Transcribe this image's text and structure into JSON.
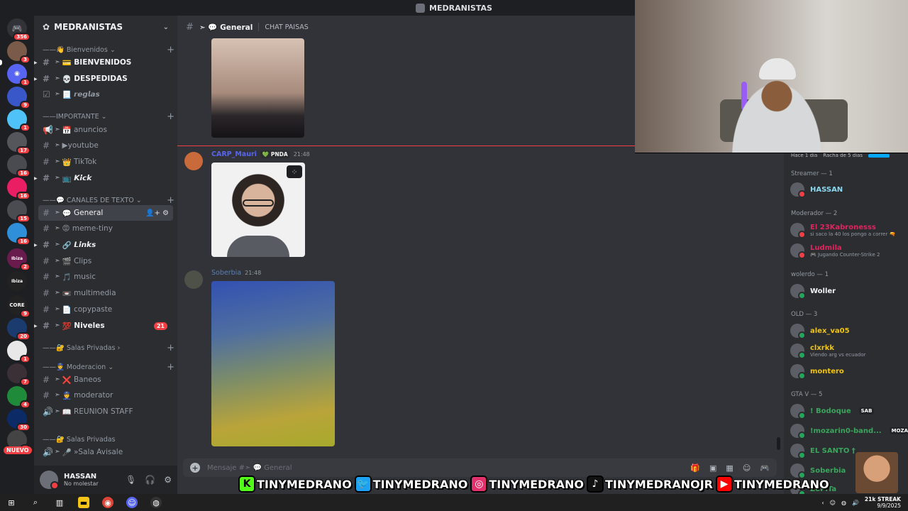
{
  "window": {
    "title": "MEDRANISTAS"
  },
  "rail": {
    "badges": [
      "356",
      "3",
      "1",
      "9",
      "1",
      "17",
      "16",
      "16",
      "15",
      "16",
      "2",
      "9",
      "20",
      "1",
      "7",
      "4",
      "30",
      "1"
    ],
    "nuevo_label": "NUEVO",
    "server_tags": [
      "Ibiza",
      "Ibiza",
      "CORE"
    ]
  },
  "sidebar": {
    "server_name": "MEDRANISTAS",
    "categories": [
      {
        "label": "Bienvenidos",
        "icon": "👋"
      },
      {
        "label": "IMPORTANTE"
      },
      {
        "label": "CANALES DE TEXTO",
        "icon": "💬"
      },
      {
        "label": "Salas Privadas",
        "icon": "🔐"
      },
      {
        "label": "Moderacion",
        "icon": "👮"
      },
      {
        "label": "Salas Privadas",
        "icon": "🔐"
      }
    ],
    "channels": [
      {
        "label": "BIENVENIDOS",
        "emoji": "💳"
      },
      {
        "label": "DESPEDIDAS",
        "emoji": "💀"
      },
      {
        "label": "𝙧𝙚𝙜𝙡𝙖𝙨",
        "emoji": "📃"
      },
      {
        "label": "anuncios",
        "emoji": "📅"
      },
      {
        "label": "youtube",
        "emoji": "▶"
      },
      {
        "label": "TikTok",
        "emoji": "👑"
      },
      {
        "label": "𝙆𝙞𝙘𝙠",
        "emoji": "📺"
      },
      {
        "label": "General",
        "emoji": "💬"
      },
      {
        "label": "meme-tiny",
        "emoji": "😡"
      },
      {
        "label": "𝙇𝙞𝙣𝙠𝙨",
        "emoji": "🔗"
      },
      {
        "label": "Clips",
        "emoji": "🎬"
      },
      {
        "label": "music",
        "emoji": "🎵"
      },
      {
        "label": "multimedia",
        "emoji": "📼"
      },
      {
        "label": "copypaste",
        "emoji": "📄"
      },
      {
        "label": "Niveles",
        "emoji": "💯",
        "mentions": "21"
      },
      {
        "label": "Baneos",
        "emoji": "❌"
      },
      {
        "label": "moderator",
        "emoji": "👮"
      },
      {
        "label": "REUNION STAFF",
        "emoji": "📖"
      },
      {
        "label": "»Sala Avisale",
        "emoji": "🎤"
      }
    ],
    "channel_prefix": "➣"
  },
  "user_panel": {
    "name": "HASSAN",
    "status": "No molestar"
  },
  "chat": {
    "channel": "General",
    "channel_emoji": "💬",
    "channel_prefix": "➣",
    "topic": "CHAT PAISAS",
    "messages": [
      {
        "author": "CARP_Mauri",
        "author_color": "#5865f2",
        "tag": "PNDA",
        "time": "21:48"
      },
      {
        "author": "Soberbia",
        "author_color": "#5b7fb5",
        "time": "21:48"
      }
    ],
    "composer_placeholder": "Mensaje #➣ 💬 General"
  },
  "overlay": {
    "handles": [
      "TINYMEDRANO",
      "TINYMEDRANO",
      "TINYMEDRANO",
      "TINYMEDRANOJR",
      "TINYMEDRANO"
    ]
  },
  "members": {
    "streak_text": [
      "Hace 1 día",
      "Racha de 5 días"
    ],
    "groups": [
      {
        "label": "Streamer — 1",
        "members": [
          {
            "name": "HASSAN",
            "color": "#8bd9f0"
          }
        ]
      },
      {
        "label": "Moderador — 2",
        "members": [
          {
            "name": "El 23Kabronesss",
            "color": "#e0245e",
            "sub": "si saco la 40 los pongo a correr 🔫"
          },
          {
            "name": "Ludmila",
            "color": "#e0245e",
            "sub": "Jugando Counter-Strike 2"
          }
        ]
      },
      {
        "label": "wolerdo — 1",
        "members": [
          {
            "name": "Woller",
            "color": "#f2f3f5"
          }
        ]
      },
      {
        "label": "OLD — 3",
        "members": [
          {
            "name": "alex_va05",
            "color": "#f1c40f"
          },
          {
            "name": "clxrkk",
            "color": "#f1c40f",
            "sub": "Viendo arg vs ecuador"
          },
          {
            "name": "montero",
            "color": "#f1c40f"
          }
        ]
      },
      {
        "label": "GTA V — 5",
        "members": [
          {
            "name": "! Bodoque",
            "color": "#3ba55d",
            "badge": "SAB"
          },
          {
            "name": "!mozarin0-band...",
            "color": "#3ba55d",
            "badge": "MOZA"
          },
          {
            "name": "EL SANTO †",
            "color": "#3ba55d"
          },
          {
            "name": "Soberbia",
            "color": "#3ba55d"
          },
          {
            "name": "ZoPiTa",
            "color": "#3ba55d"
          }
        ]
      }
    ]
  },
  "taskbar": {
    "date": "9/9/2025",
    "brand": "21k STREAK"
  },
  "colors": {
    "accent": "#5865f2",
    "danger": "#f23f43",
    "online": "#23a55a"
  }
}
